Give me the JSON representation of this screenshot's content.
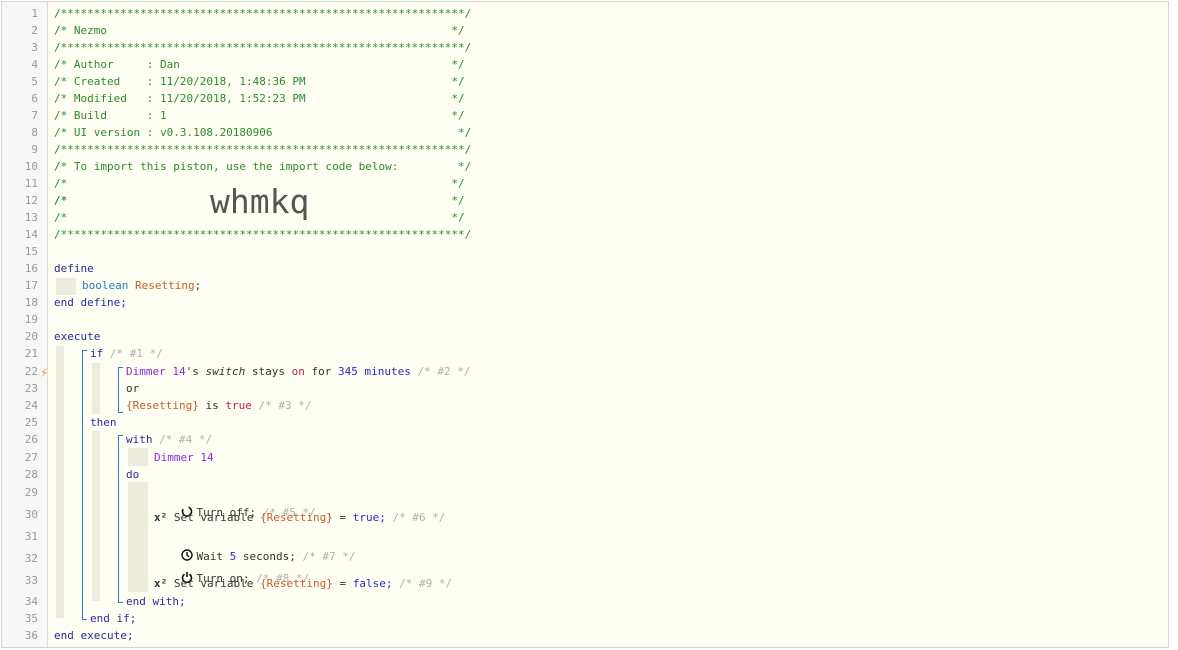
{
  "header": {
    "border": "/*************************************************************/",
    "name_line": "/* Nezmo                                                    */",
    "author_line": "/* Author     : Dan                                         */",
    "created_line": "/* Created    : 11/20/2018, 1:48:36 PM                      */",
    "modified_line": "/* Modified   : 11/20/2018, 1:52:23 PM                      */",
    "build_line": "/* Build      : 1                                           */",
    "ui_line": "/* UI version : v0.3.108.20180906                            */",
    "import_line": "/* To import this piston, use the import code below:         */",
    "blank_line": "/*                                                          */",
    "import_prefix": "/*               ",
    "import_code": "whmkq",
    "import_suffix": "                   */"
  },
  "line_numbers": [
    "1",
    "2",
    "3",
    "4",
    "5",
    "6",
    "7",
    "8",
    "9",
    "10",
    "11",
    "12",
    "13",
    "14",
    "15",
    "16",
    "17",
    "18",
    "19",
    "20",
    "21",
    "22",
    "23",
    "24",
    "25",
    "26",
    "27",
    "28",
    "29",
    "30",
    "31",
    "32",
    "33",
    "34",
    "35",
    "36"
  ],
  "code": {
    "define": "define",
    "boolean": "boolean",
    "var_name": "Resetting",
    "semi": ";",
    "end_define": "end define;",
    "execute": "execute",
    "if": "if",
    "c1": "/* #1 */",
    "dimmer": "Dimmer 14",
    "possessive": "'s ",
    "switch_word": "switch",
    "stays": " stays ",
    "on": "on",
    "for": " for ",
    "minutes_num": "345",
    "minutes": " minutes",
    "c2": "/* #2 */",
    "or": "or",
    "resetting_ref": "{Resetting}",
    "is": " is ",
    "true": "true",
    "c3": "/* #3 */",
    "then": "then",
    "with": "with",
    "c4": "/* #4 */",
    "do": "do",
    "turn_off": "Turn off;",
    "c5": "/* #5 */",
    "set_variable": "Set variable ",
    "eq": " = ",
    "true_semi": "true;",
    "c6": "/* #6 */",
    "wait": "Wait ",
    "wait_num": "5",
    "seconds": " seconds;",
    "c7": "/* #7 */",
    "turn_on": "Turn on;",
    "c8": "/* #8 */",
    "false_semi": "false;",
    "c9": "/* #9 */",
    "end_with": "end with;",
    "end_if": "end if;",
    "end_execute": "end execute;"
  },
  "icons": {
    "power_off": "power-off-icon",
    "set_variable": "x²",
    "wait": "clock-icon",
    "power_on": "power-on-icon",
    "warning": "lightning-icon"
  }
}
